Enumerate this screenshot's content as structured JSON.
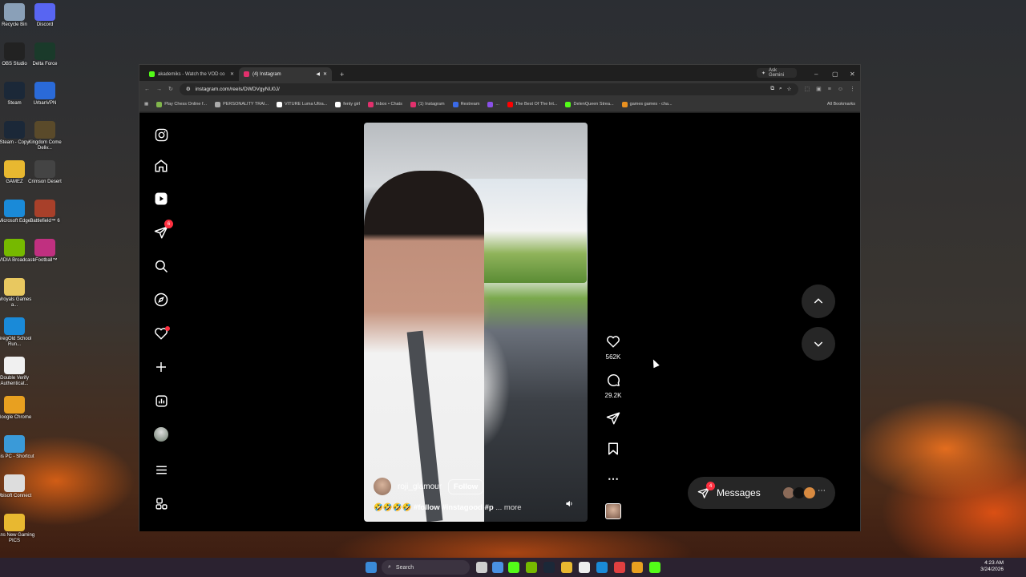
{
  "desktop": {
    "icons": [
      {
        "label": "Recycle Bin",
        "color": "#8aa0b8"
      },
      {
        "label": "Discord",
        "color": "#5865f2"
      },
      {
        "label": "OBS Studio",
        "color": "#222222"
      },
      {
        "label": "Delta Force",
        "color": "#1a3a2a"
      },
      {
        "label": "Steam",
        "color": "#1b2838"
      },
      {
        "label": "UrbanVPN",
        "color": "#2a6ad8"
      },
      {
        "label": "Steam - Copy",
        "color": "#1b2838"
      },
      {
        "label": "Kingdom Come Deliv...",
        "color": "#5a4a2a"
      },
      {
        "label": "GAMEZ",
        "color": "#e8b830"
      },
      {
        "label": "Crimson Desert",
        "color": "#444444"
      },
      {
        "label": "Microsoft Edge",
        "color": "#1a8ad8"
      },
      {
        "label": "Battlefield™ 6",
        "color": "#a8402a"
      },
      {
        "label": "NVIDIA Broadcast",
        "color": "#76b900"
      },
      {
        "label": "eFootball™",
        "color": "#c03080"
      },
      {
        "label": "Wroyals Games a...",
        "color": "#e8c860"
      },
      {
        "label": "GregOld School Run...",
        "color": "#1a8ad8"
      },
      {
        "label": "Double Verify Authenticat...",
        "color": "#f0f0f0"
      },
      {
        "label": "Google Chrome",
        "color": "#e8a020"
      },
      {
        "label": "This PC - Shortcut",
        "color": "#3a9ad8"
      },
      {
        "label": "Ubisoft Connect",
        "color": "#dddddd"
      },
      {
        "label": "Dans New Gaming PICS",
        "color": "#e8b830"
      }
    ]
  },
  "browser": {
    "tabs": [
      {
        "title": "akademiks - Watch the VOD co",
        "fav_color": "#53fc18"
      },
      {
        "title": "(4) Instagram",
        "fav_color": "#e1306c"
      }
    ],
    "new_tab": "+",
    "ask_gemini": "Ask Gemini",
    "url": "instagram.com/reels/DWDVgyNU0J/",
    "bookmarks": [
      {
        "label": "Play Chess Online f...",
        "color": "#81b64c"
      },
      {
        "label": "PERSONALITY TRAI...",
        "color": "#aaaaaa"
      },
      {
        "label": "VITURE Luma Ultra...",
        "color": "#ffffff"
      },
      {
        "label": "fenty girl",
        "color": "#ffffff"
      },
      {
        "label": "Inbox • Chats",
        "color": "#e1306c"
      },
      {
        "label": "(1) Instagram",
        "color": "#e1306c"
      },
      {
        "label": "Restream",
        "color": "#3a6ae8"
      },
      {
        "label": "...",
        "color": "#8a50e8"
      },
      {
        "label": "The Best Of The Int...",
        "color": "#ff0000"
      },
      {
        "label": "DelenQueen Strea...",
        "color": "#53fc18"
      },
      {
        "label": "games games - cha...",
        "color": "#e89020"
      }
    ],
    "all_bookmarks": "All Bookmarks"
  },
  "instagram": {
    "rail_badges": {
      "messages": "6"
    },
    "reel": {
      "username": "roji_glamour",
      "follow_label": "Follow",
      "caption": "🤣🤣🤣🤣 #follow #instagood #p",
      "more_label": "... more",
      "likes": "562K",
      "comments": "29.2K"
    },
    "messages": {
      "label": "Messages",
      "badge": "4"
    }
  },
  "taskbar": {
    "search_placeholder": "Search",
    "time": "4:23 AM",
    "date": "3/24/2026"
  }
}
